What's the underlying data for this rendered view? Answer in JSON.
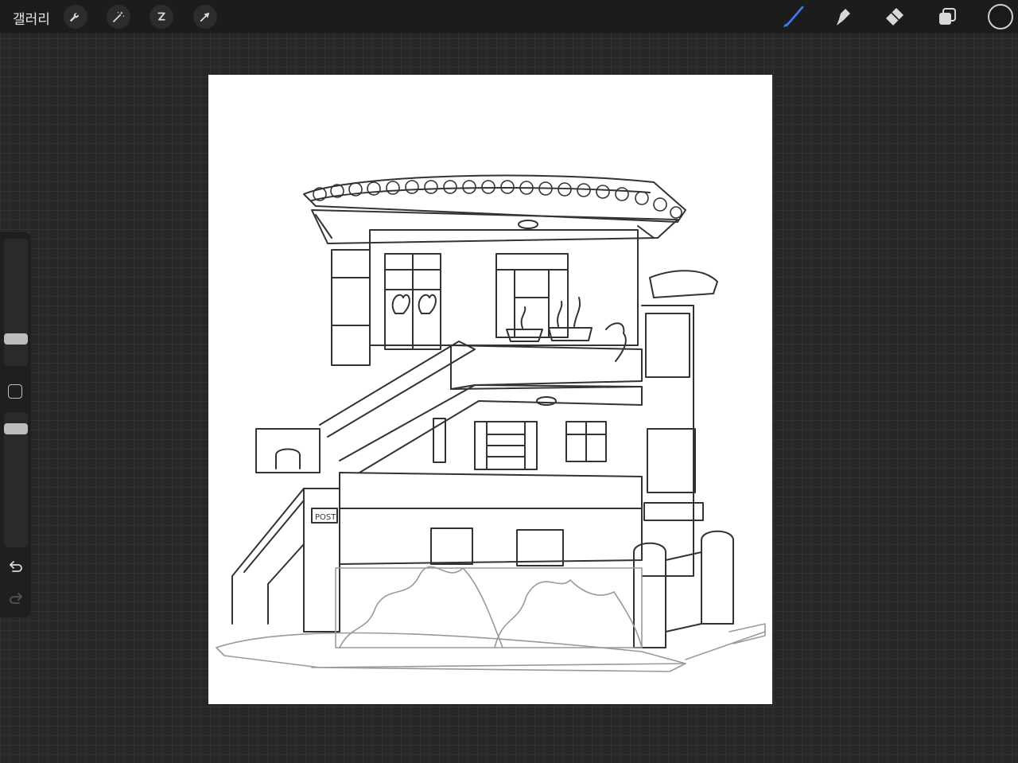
{
  "topbar": {
    "gallery_label": "갤러리",
    "left_tools": [
      {
        "name": "actions",
        "icon": "wrench-icon"
      },
      {
        "name": "adjustments",
        "icon": "magic-wand-icon"
      },
      {
        "name": "selection",
        "icon": "selection-s-icon"
      },
      {
        "name": "transform",
        "icon": "arrow-cursor-icon"
      }
    ],
    "right_tools": [
      {
        "name": "brush",
        "icon": "brush-icon",
        "active": true
      },
      {
        "name": "smudge",
        "icon": "smudge-icon"
      },
      {
        "name": "eraser",
        "icon": "eraser-icon"
      },
      {
        "name": "layers",
        "icon": "layers-icon"
      }
    ],
    "current_color": "#1a1a1a",
    "active_color": "#3d7bf7"
  },
  "sidebar": {
    "brush_size_level": 0.2,
    "opacity_level": 0.8,
    "undo_icon": "undo-icon",
    "redo_icon": "redo-icon"
  },
  "canvas": {
    "artwork": "line-drawing-two-storey-house",
    "mailbox_text": "POST"
  }
}
